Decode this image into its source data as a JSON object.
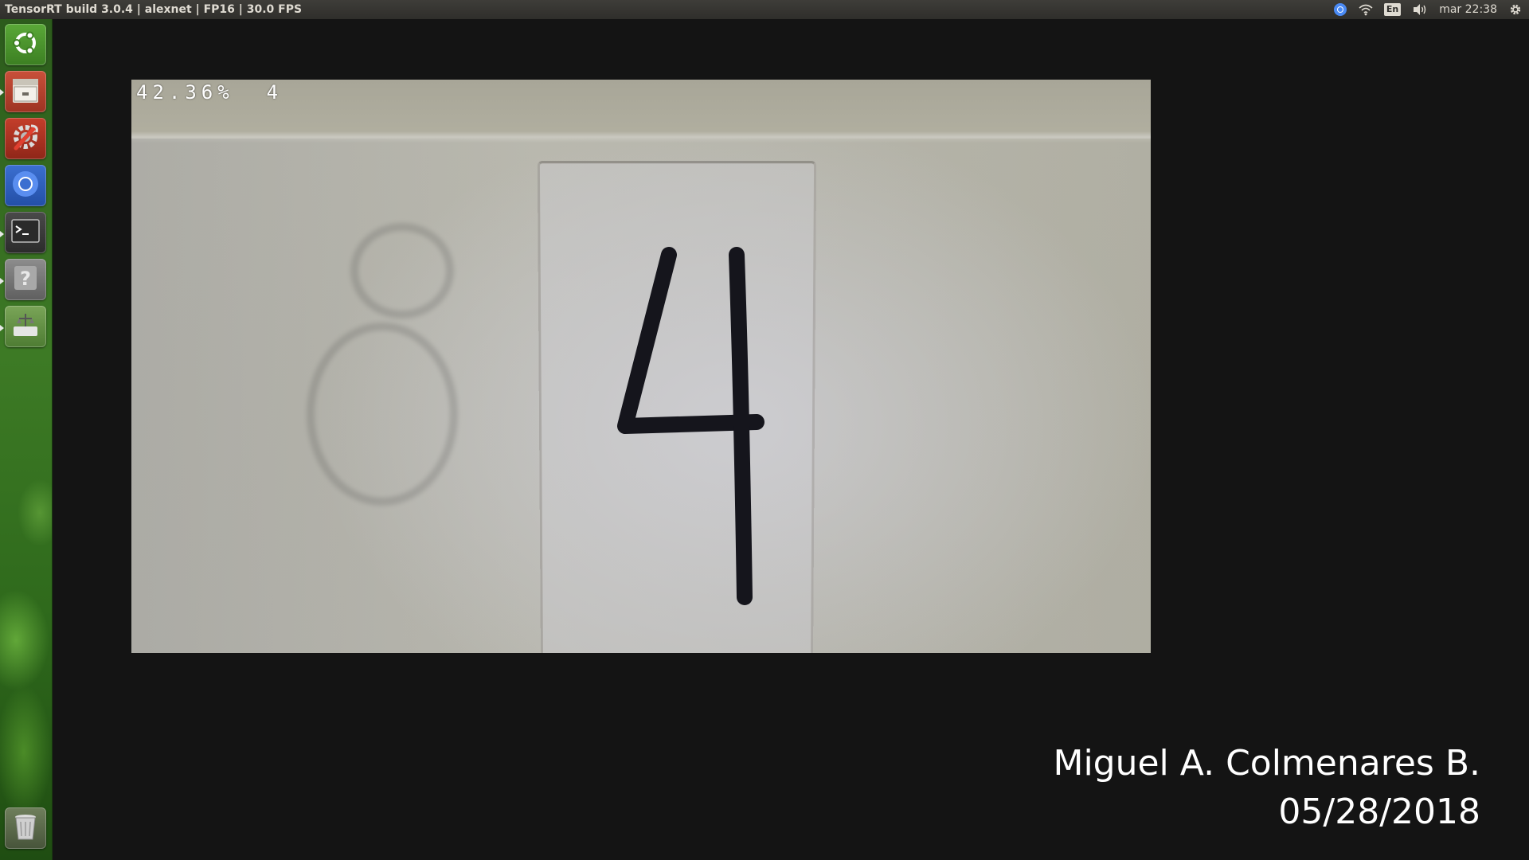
{
  "top_panel": {
    "window_title": "TensorRT build 3.0.4 | alexnet | FP16 | 30.0 FPS",
    "keyboard_layout": "En",
    "clock": "mar 22:38",
    "icons": [
      "chromium-indicator-icon",
      "wifi-icon",
      "keyboard-layout-icon",
      "volume-icon",
      "system-gear-icon"
    ]
  },
  "launcher": {
    "items": [
      {
        "name": "ubuntu-dash",
        "icon": "ubuntu-logo-icon"
      },
      {
        "name": "files",
        "icon": "file-cabinet-icon"
      },
      {
        "name": "system-settings",
        "icon": "settings-tools-icon"
      },
      {
        "name": "chromium",
        "icon": "chromium-icon"
      },
      {
        "name": "terminal",
        "icon": "terminal-icon"
      },
      {
        "name": "help",
        "icon": "help-question-icon"
      },
      {
        "name": "jetson-app",
        "icon": "scale-icon"
      },
      {
        "name": "trash",
        "icon": "trash-icon"
      }
    ],
    "accent_color": "#3d7a25"
  },
  "camera": {
    "overlay": "42.36%  4",
    "digit_shown": "4"
  },
  "credits": {
    "author": "Miguel A. Colmenares B.",
    "date": "05/28/2018"
  }
}
